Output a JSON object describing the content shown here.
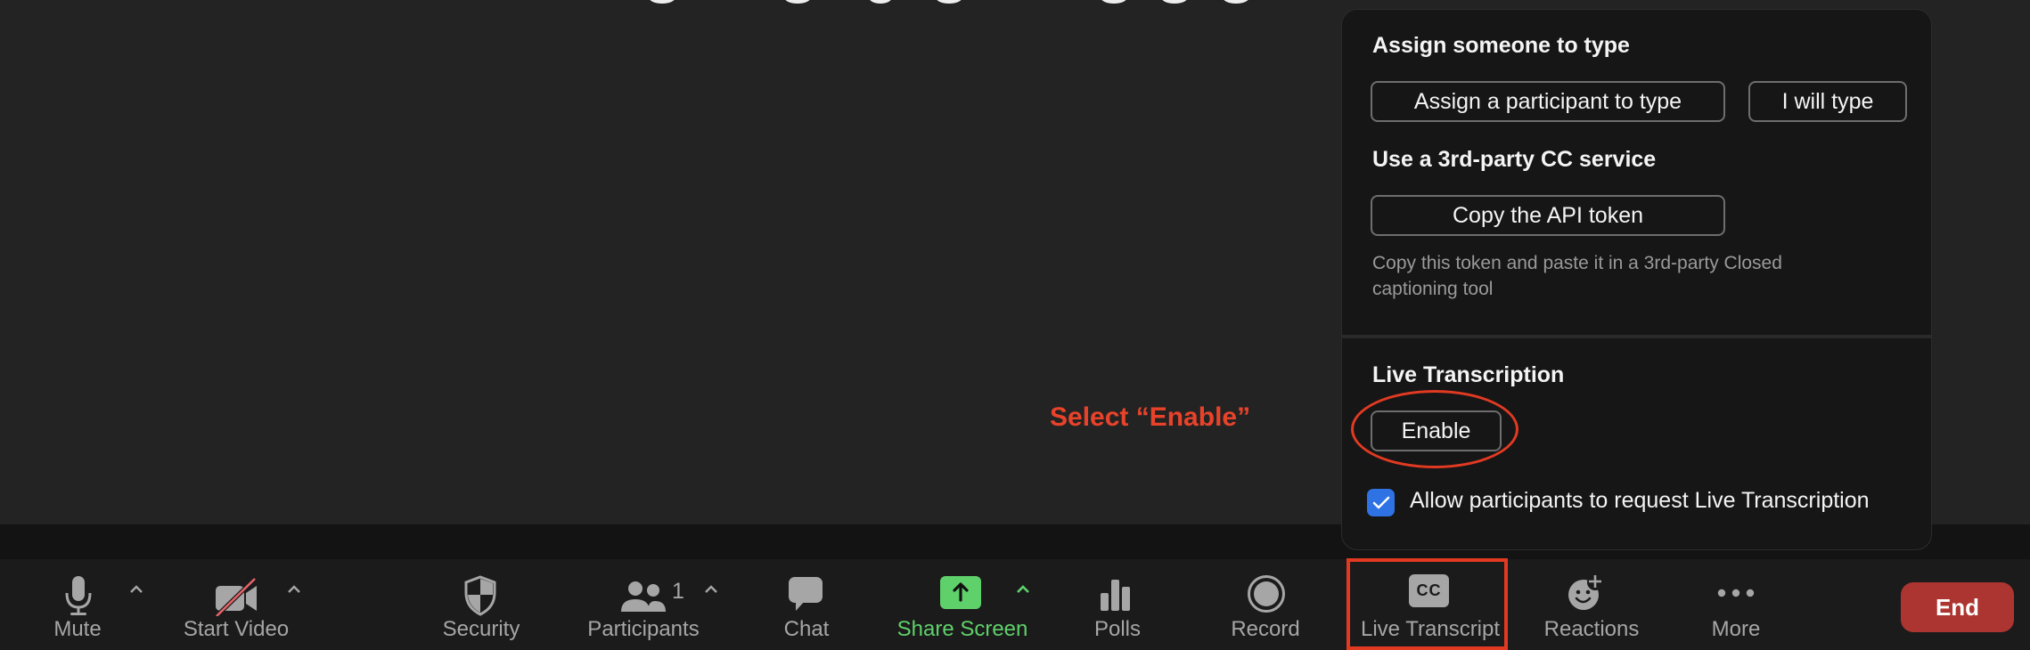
{
  "annotation": {
    "instruction": "Select “Enable”",
    "color": "#e8432a"
  },
  "cc_panel": {
    "assign_section": {
      "heading": "Assign someone to type",
      "assign_participant_button": "Assign a participant to type",
      "i_will_type_button": "I will type"
    },
    "third_party_section": {
      "heading": "Use a 3rd-party CC service",
      "copy_token_button": "Copy the API token",
      "note": "Copy this token and paste it in a 3rd-party Closed captioning tool"
    },
    "live_transcription_section": {
      "heading": "Live Transcription",
      "enable_button": "Enable",
      "allow_request_checkbox": {
        "label": "Allow participants to request Live Transcription",
        "checked": true
      }
    }
  },
  "toolbar": {
    "mute": {
      "label": "Mute",
      "icon": "microphone-icon"
    },
    "start_video": {
      "label": "Start Video",
      "icon": "video-off-icon"
    },
    "security": {
      "label": "Security",
      "icon": "shield-icon"
    },
    "participants": {
      "label": "Participants",
      "icon": "participants-icon",
      "count": "1"
    },
    "chat": {
      "label": "Chat",
      "icon": "chat-bubble-icon"
    },
    "share_screen": {
      "label": "Share Screen",
      "icon": "share-arrow-icon",
      "color": "#5fd16b"
    },
    "polls": {
      "label": "Polls",
      "icon": "bar-chart-icon"
    },
    "record": {
      "label": "Record",
      "icon": "record-icon"
    },
    "live_transcript": {
      "label": "Live Transcript",
      "icon": "cc-icon",
      "icon_text": "CC"
    },
    "reactions": {
      "label": "Reactions",
      "icon": "emoji-add-icon"
    },
    "more": {
      "label": "More",
      "icon": "ellipsis-icon"
    },
    "end": {
      "label": "End",
      "color": "#ad3531"
    }
  }
}
